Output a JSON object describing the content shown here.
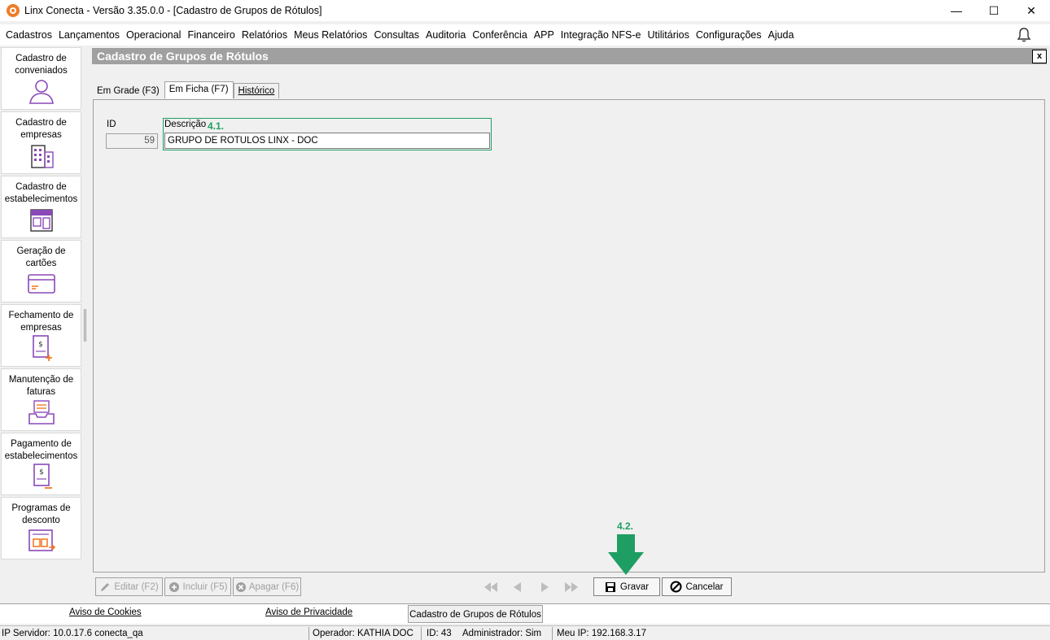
{
  "window": {
    "title": "Linx Conecta - Versão 3.35.0.0 - [Cadastro de Grupos de Rótulos]",
    "minimize": "—",
    "maximize": "☐",
    "close": "✕"
  },
  "menu": [
    "Cadastros",
    "Lançamentos",
    "Operacional",
    "Financeiro",
    "Relatórios",
    "Meus Relatórios",
    "Consultas",
    "Auditoria",
    "Conferência",
    "APP",
    "Integração NFS-e",
    "Utilitários",
    "Configurações",
    "Ajuda"
  ],
  "sidebar": {
    "items": [
      {
        "label": "Cadastro de conveniados",
        "icon": "user-icon"
      },
      {
        "label": "Cadastro de empresas",
        "icon": "building-icon"
      },
      {
        "label": "Cadastro de estabelecimentos",
        "icon": "store-icon"
      },
      {
        "label": "Geração de cartões",
        "icon": "card-icon"
      },
      {
        "label": "Fechamento de empresas",
        "icon": "invoice-add-icon"
      },
      {
        "label": "Manutenção de faturas",
        "icon": "inbox-icon"
      },
      {
        "label": "Pagamento de estabelecimentos",
        "icon": "payment-icon"
      },
      {
        "label": "Programas de desconto",
        "icon": "discount-icon"
      }
    ],
    "accent": "#8b49b8"
  },
  "form": {
    "title": "Cadastro de Grupos de Rótulos",
    "close_label": "x",
    "tabs": [
      {
        "label": "Em Grade (F3)"
      },
      {
        "label": "Em Ficha (F7)"
      },
      {
        "label": "Histórico"
      }
    ],
    "fields": {
      "id_label": "ID",
      "id_value": "59",
      "desc_label": "Descrição",
      "desc_value": "GRUPO DE RÓTULOS LINX - DOC"
    },
    "annotations": {
      "a1": "4.1.",
      "a2": "4.2.",
      "color": "#1f9e64"
    },
    "buttons": {
      "edit": "Editar (F2)",
      "include": "Incluir (F5)",
      "delete": "Apagar (F6)",
      "save": "Gravar",
      "cancel": "Cancelar"
    }
  },
  "footer": {
    "cookies": "Aviso de Cookies",
    "privacy": "Aviso de Privacidade",
    "active_tab": "Cadastro de Grupos de Rótulos"
  },
  "status": {
    "server": "IP Servidor: 10.0.17.6 conecta_qa",
    "operator": "Operador: KATHIA DOC",
    "id": "ID: 43",
    "admin": "Administrador: Sim",
    "my_ip": "Meu IP: 192.168.3.17"
  }
}
